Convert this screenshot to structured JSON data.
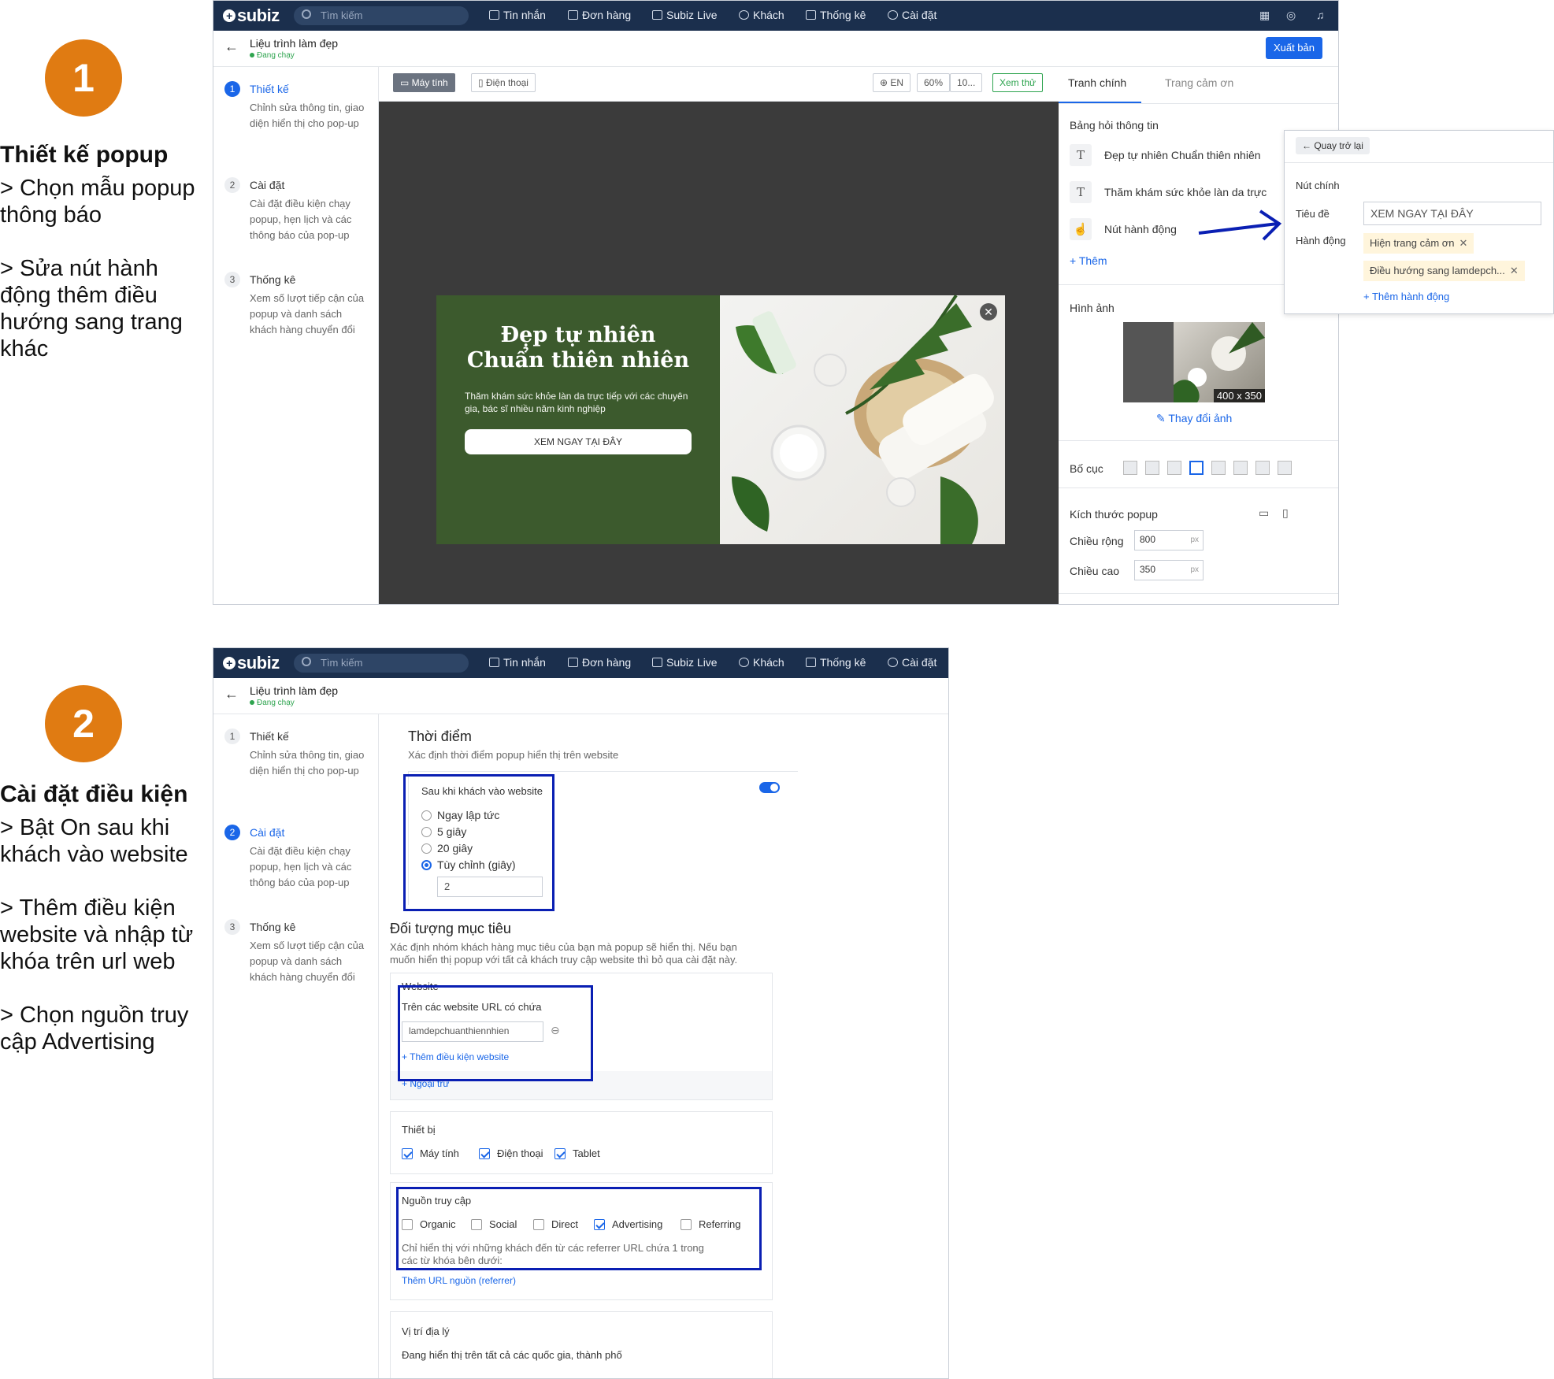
{
  "steps": [
    {
      "number": "1",
      "heading": "Thiết kế popup",
      "lines": [
        "> Chọn mẫu popup",
        "thông báo",
        "",
        "> Sửa nút hành",
        "động thêm điều",
        "hướng sang trang",
        "khác"
      ]
    },
    {
      "number": "2",
      "heading": "Cài đặt điều kiện",
      "lines": [
        "> Bật On sau khi",
        "khách vào website",
        "",
        "> Thêm điều kiện",
        "website và nhập từ",
        "khóa trên url web",
        "",
        "> Chọn nguồn truy",
        "cập Advertising"
      ]
    }
  ],
  "app": {
    "logo": "subiz",
    "search_placeholder": "Tìm kiếm",
    "nav": [
      "Tin nhắn",
      "Đơn hàng",
      "Subiz Live",
      "Khách",
      "Thống kê",
      "Cài đặt"
    ],
    "page_title": "Liệu trình làm đẹp",
    "status": "Đang chạy",
    "publish": "Xuất bản",
    "sidebar": [
      {
        "num": "1",
        "title": "Thiết kế",
        "desc": "Chỉnh sửa thông tin, giao diện hiển thị cho pop-up"
      },
      {
        "num": "2",
        "title": "Cài đặt",
        "desc": "Cài đặt điều kiện chạy popup, hẹn lịch và các thông báo của pop-up"
      },
      {
        "num": "3",
        "title": "Thống kê",
        "desc": "Xem số lượt tiếp cận của popup và danh sách khách hàng chuyển đổi"
      }
    ]
  },
  "editor": {
    "view_desktop": "Máy tính",
    "view_mobile": "Điện thoại",
    "lang": "EN",
    "zoom": "60%",
    "zoom2": "10...",
    "preview": "Xem thử",
    "popup": {
      "title1": "Đẹp tự nhiên",
      "title2": "Chuẩn thiên nhiên",
      "subtitle": "Thăm khám sức khỏe làn da trực tiếp với các chuyên gia, bác sĩ nhiều năm kinh nghiệp",
      "button": "XEM NGAY TẠI ĐÂY",
      "close": "✕"
    },
    "tabs": [
      "Tranh chính",
      "Trang cảm ơn"
    ],
    "form_label": "Bảng hỏi thông tin",
    "fields": [
      {
        "icon": "T",
        "label": "Đẹp tự nhiên Chuẩn thiên nhiên"
      },
      {
        "icon": "T",
        "label": "Thăm khám sức khỏe làn da trực"
      },
      {
        "icon": "☝",
        "label": "Nút hành động"
      }
    ],
    "add": "+ Thêm",
    "image_label": "Hình ảnh",
    "image_size": "400 x 350",
    "change_image": "Thay đổi ảnh",
    "layout_label": "Bố cục",
    "size_label": "Kích thước popup",
    "width_label": "Chiều rộng",
    "width_value": "800",
    "height_label": "Chiều cao",
    "height_value": "350",
    "unit": "px",
    "subpanel": {
      "back": "Quay trở lại",
      "section": "Nút chính",
      "title_label": "Tiêu đề",
      "title_value": "XEM NGAY TẠI ĐÂY",
      "action_label": "Hành động",
      "tags": [
        "Hiện trang cảm ơn",
        "Điều hướng sang lamdepch..."
      ],
      "add_action": "+ Thêm hành động"
    }
  },
  "settings": {
    "timing_title": "Thời điểm",
    "timing_sub": "Xác định thời điểm popup hiển thị trên website",
    "after_visit": "Sau khi khách vào website",
    "options": [
      "Ngay lập tức",
      "5 giây",
      "20 giây",
      "Tùy chỉnh (giây)"
    ],
    "custom_value": "2",
    "target_title": "Đối tượng mục tiêu",
    "target_sub1": "Xác định nhóm khách hàng mục tiêu của bạn mà popup sẽ hiển thị. Nếu bạn",
    "target_sub2": "muốn hiển thị popup với tất cả khách truy cập website thì bỏ qua cài đặt này.",
    "website_label": "Website",
    "url_contains": "Trên các website URL có chứa",
    "url_value": "lamdepchuanthiennhien",
    "add_website": "+ Thêm điều kiện website",
    "except": "+ Ngoại trừ",
    "device_label": "Thiết bị",
    "devices": [
      "Máy tính",
      "Điện thoại",
      "Tablet"
    ],
    "source_label": "Nguồn truy cập",
    "sources": [
      "Organic",
      "Social",
      "Direct",
      "Advertising",
      "Referring"
    ],
    "source_note1": "Chỉ hiển thị với những khách đến từ các referrer URL chứa 1 trong",
    "source_note2": "các từ khóa bên dưới:",
    "add_referrer": "Thêm URL nguồn (referrer)",
    "geo_label": "Vị trí địa lý",
    "geo_text": "Đang hiển thị trên tất cả các quốc gia, thành phố"
  }
}
